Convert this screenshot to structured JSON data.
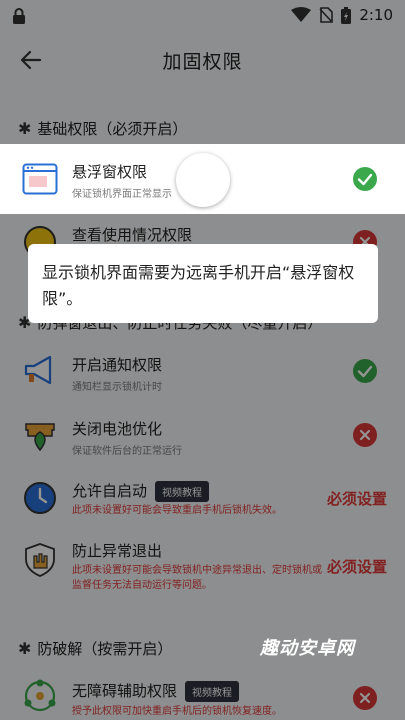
{
  "status_bar": {
    "time": "2:10"
  },
  "app_bar": {
    "title": "加固权限"
  },
  "sections": {
    "basic": "基础权限（必须开启）",
    "prevent": "防弹窗退出、防止时任务失败（尽量开启）",
    "anticrack": "防破解（按需开启）"
  },
  "items": {
    "overlay": {
      "name": "悬浮窗权限",
      "sub": "保证锁机界面正常显示"
    },
    "usage": {
      "name": "查看使用情况权限"
    },
    "notify": {
      "name": "开启通知权限",
      "sub": "通知栏显示锁机计时"
    },
    "battery": {
      "name": "关闭电池优化",
      "sub": "保证软件后台的正常运行"
    },
    "autostart": {
      "name": "允许自启动",
      "tag": "视频教程",
      "warn": "此项未设置好可能会导致重启手机后锁机失效。",
      "action": "必须设置"
    },
    "antiexit": {
      "name": "防止异常退出",
      "warn": "此项未设置好可能会导致锁机中途异常退出、定时锁机或监督任务无法自动运行等问题。",
      "action": "必须设置"
    },
    "accessibility": {
      "name": "无障碍辅助权限",
      "tag": "视频教程",
      "warn": "授予此权限可加快重启手机后的锁机恢复速度。"
    }
  },
  "tooltip": {
    "text": "显示锁机界面需要为远离手机开启“悬浮窗权限”。"
  },
  "watermark": "趣动安卓网",
  "colors": {
    "ok": "#3aa84b",
    "bad": "#d93838",
    "warn": "#e03a3a",
    "tag_bg": "#2f3340"
  }
}
